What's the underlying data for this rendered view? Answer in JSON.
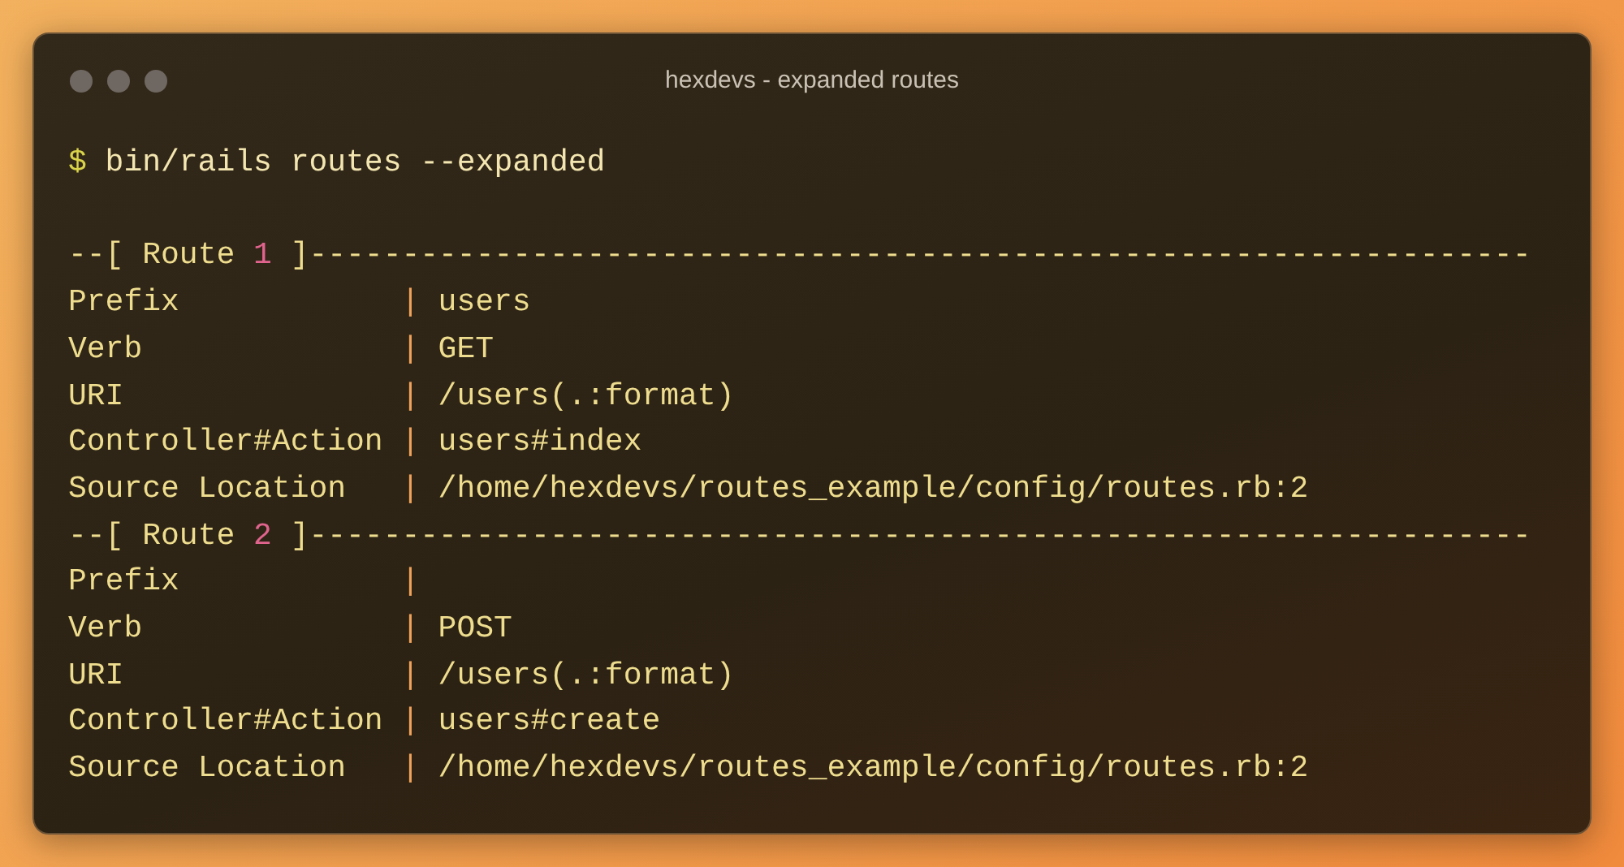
{
  "window": {
    "title": "hexdevs - expanded routes"
  },
  "command": {
    "prompt": "$",
    "text": "bin/rails routes --expanded"
  },
  "routes": [
    {
      "header": {
        "lead": "--[ Route",
        "number": "1",
        "tail": "]------------------------------------------------------------------"
      },
      "fields": [
        {
          "label": "Prefix",
          "separator": "|",
          "value": "users"
        },
        {
          "label": "Verb",
          "separator": "|",
          "value": "GET"
        },
        {
          "label": "URI",
          "separator": "|",
          "value": "/users(.:format)"
        },
        {
          "label": "Controller#Action",
          "separator": "|",
          "value": "users#index"
        },
        {
          "label": "Source Location",
          "separator": "|",
          "value": "/home/hexdevs/routes_example/config/routes.rb:2"
        }
      ]
    },
    {
      "header": {
        "lead": "--[ Route",
        "number": "2",
        "tail": "]------------------------------------------------------------------"
      },
      "fields": [
        {
          "label": "Prefix",
          "separator": "|"
        },
        {
          "label": "Verb",
          "separator": "|",
          "value": "POST"
        },
        {
          "label": "URI",
          "separator": "|",
          "value": "/users(.:format)"
        },
        {
          "label": "Controller#Action",
          "separator": "|",
          "value": "users#create"
        },
        {
          "label": "Source Location",
          "separator": "|",
          "value": "/home/hexdevs/routes_example/config/routes.rb:2"
        }
      ]
    }
  ]
}
